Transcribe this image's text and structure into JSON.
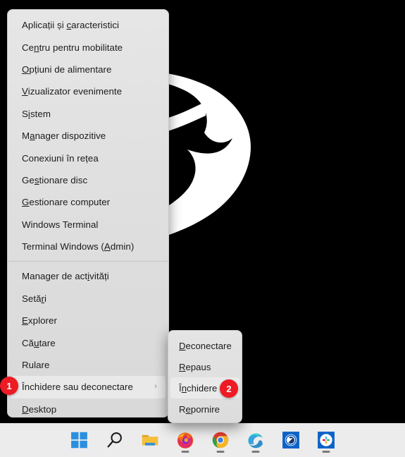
{
  "desktop": {
    "wallpaper_name": "abstract-brushstroke-wallpaper",
    "background_color": "#000000",
    "art_color": "#ffffff"
  },
  "winx_menu": {
    "name": "Win+X power user menu",
    "groups": [
      {
        "items": [
          {
            "label": "Aplicații și caracteristici",
            "accel_index": 13
          },
          {
            "label": "Centru pentru mobilitate",
            "accel_index": 2
          },
          {
            "label": "Opțiuni de alimentare",
            "accel_index": 0
          },
          {
            "label": "Vizualizator evenimente",
            "accel_index": 0
          },
          {
            "label": "Sistem",
            "accel_index": 1
          },
          {
            "label": "Manager dispozitive",
            "accel_index": 1
          },
          {
            "label": "Conexiuni în rețea",
            "accel_index": -1
          },
          {
            "label": "Gestionare disc",
            "accel_index": 2
          },
          {
            "label": "Gestionare computer",
            "accel_index": 0
          },
          {
            "label": "Windows Terminal",
            "accel_index": -1
          },
          {
            "label": "Terminal Windows (Admin)",
            "accel_index": 18
          }
        ]
      },
      {
        "items": [
          {
            "label": "Manager de activități",
            "accel_index": 14
          },
          {
            "label": "Setări",
            "accel_index": 4
          },
          {
            "label": "Explorer",
            "accel_index": 0
          },
          {
            "label": "Căutare",
            "accel_index": 2
          },
          {
            "label": "Rulare",
            "accel_index": -1
          },
          {
            "label": "Închidere sau deconectare",
            "accel_index": -1,
            "has_submenu": true,
            "highlighted": true,
            "chevron": "›"
          },
          {
            "label": "Desktop",
            "accel_index": 0
          }
        ]
      }
    ]
  },
  "shutdown_submenu": {
    "name": "Închidere sau deconectare submenu",
    "items": [
      {
        "label": "Deconectare",
        "accel_index": 0
      },
      {
        "label": "Repaus",
        "accel_index": 0
      },
      {
        "label": "Închidere",
        "accel_index": 1,
        "highlighted": true
      },
      {
        "label": "Repornire",
        "accel_index": 1
      }
    ]
  },
  "callouts": [
    {
      "id": "1",
      "text": "1",
      "color": "#ed1b24"
    },
    {
      "id": "2",
      "text": "2",
      "color": "#ed1b24"
    }
  ],
  "taskbar": {
    "background": "#ececed",
    "items": [
      {
        "name": "start-button",
        "icon": "windows-logo-icon",
        "running": false
      },
      {
        "name": "search-button",
        "icon": "search-icon",
        "running": false
      },
      {
        "name": "file-explorer",
        "icon": "folder-icon",
        "running": false
      },
      {
        "name": "firefox",
        "icon": "firefox-icon",
        "running": true
      },
      {
        "name": "google-chrome",
        "icon": "chrome-icon",
        "running": true
      },
      {
        "name": "microsoft-edge",
        "icon": "edge-icon",
        "running": true
      },
      {
        "name": "blue-s-app",
        "icon": "blue-s-app-icon",
        "running": false
      },
      {
        "name": "slack",
        "icon": "slack-icon",
        "running": true
      }
    ]
  }
}
